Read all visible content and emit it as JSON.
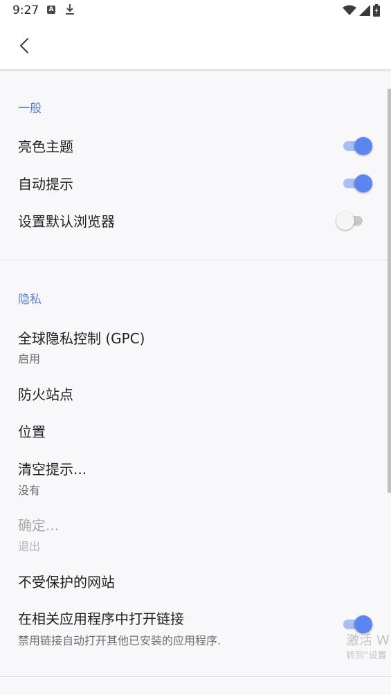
{
  "status_bar": {
    "time": "9:27",
    "icons": [
      "text-a-icon",
      "download-icon",
      "wifi-icon",
      "signal-icon",
      "battery-charging-icon"
    ]
  },
  "app_bar": {
    "back_icon": "chevron-left-icon"
  },
  "sections": {
    "general": {
      "title": "一般",
      "items": [
        {
          "label": "亮色主题",
          "toggle": true
        },
        {
          "label": "自动提示",
          "toggle": true
        },
        {
          "label": "设置默认浏览器",
          "toggle": false
        }
      ]
    },
    "privacy": {
      "title": "隐私",
      "items": [
        {
          "label": "全球隐私控制 (GPC)",
          "subtitle": "启用"
        },
        {
          "label": "防火站点"
        },
        {
          "label": "位置"
        },
        {
          "label": "清空提示...",
          "subtitle": "没有"
        },
        {
          "label": "确定...",
          "subtitle": "退出",
          "disabled": true
        },
        {
          "label": "不受保护的网站"
        },
        {
          "label": "在相关应用程序中打开链接",
          "subtitle": "禁用链接自动打开其他已安装的应用程序.",
          "toggle": true
        }
      ]
    }
  },
  "watermark": {
    "line1": "激活 W",
    "line2": "转到“设置"
  },
  "colors": {
    "accent": "#5b86f0",
    "section_title": "#5a7fd6",
    "background": "#f8f8fa"
  }
}
